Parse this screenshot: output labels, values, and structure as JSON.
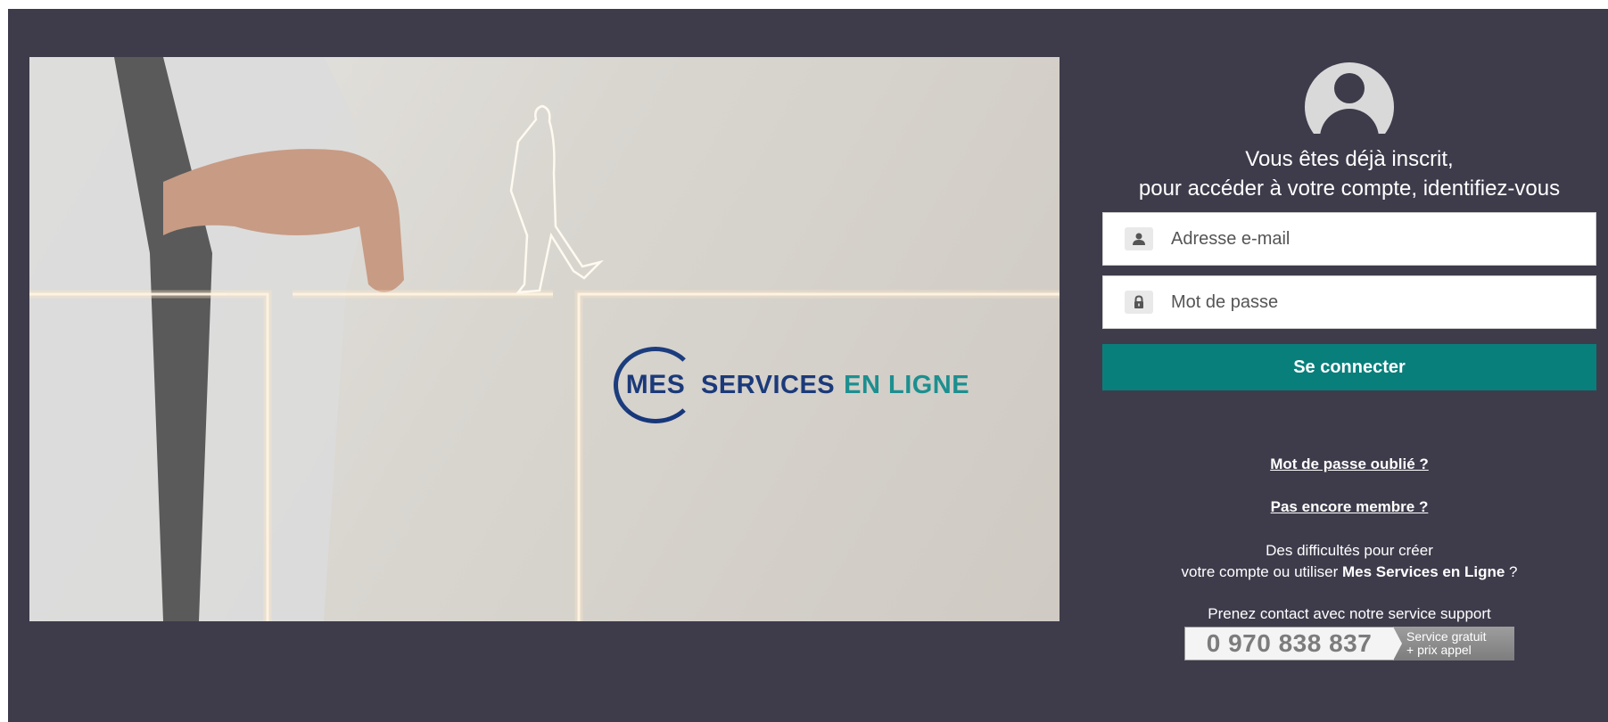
{
  "hero": {
    "logo": {
      "mes": "MES",
      "services": "SERVICES",
      "en_ligne": "EN LIGNE"
    }
  },
  "login": {
    "avatar_icon": "user-avatar-icon",
    "welcome_line1": "Vous êtes déjà inscrit,",
    "welcome_line2": "pour accéder à votre compte, identifiez-vous",
    "email_placeholder": "Adresse e-mail",
    "email_icon": "user-icon",
    "password_placeholder": "Mot de passe",
    "password_icon": "lock-icon",
    "submit_label": "Se connecter"
  },
  "links": {
    "forgot_password": "Mot de passe oublié ?",
    "not_member": "Pas encore membre ?"
  },
  "help": {
    "line1": "Des difficultés pour créer",
    "line2_prefix": "votre compte ou utiliser ",
    "line2_brand": "Mes Services en Ligne",
    "line2_suffix": " ?"
  },
  "support": {
    "contact_text": "Prenez contact avec notre service support",
    "phone_number": "0 970 838 837",
    "tag_line1": "Service gratuit",
    "tag_line2": "+ prix appel"
  },
  "colors": {
    "background": "#3e3c4b",
    "button": "#097f7c",
    "logo_blue": "#1b3a7a",
    "logo_teal": "#1d8f8f"
  }
}
